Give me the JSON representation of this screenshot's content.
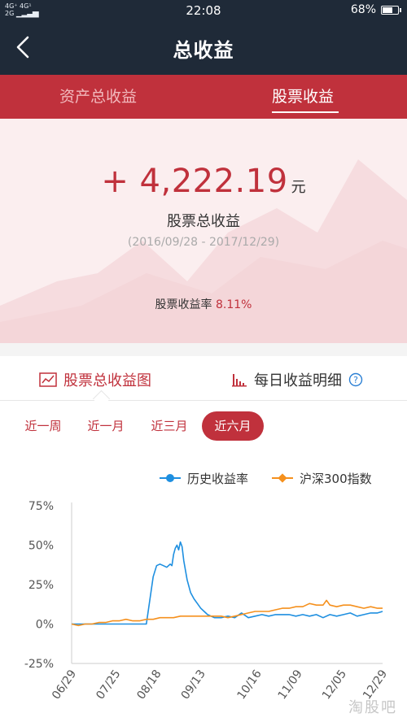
{
  "status_bar": {
    "network_top": "4G⁺ 4G¹",
    "network_bottom": "2G",
    "time": "22:08",
    "battery": "68%",
    "battery_level": 0.68
  },
  "header": {
    "title": "总收益"
  },
  "tabs": [
    {
      "label": "资产总收益",
      "active": false
    },
    {
      "label": "股票收益",
      "active": true
    }
  ],
  "summary": {
    "total_value": "+ 4,222.19",
    "unit": "元",
    "label": "股票总收益",
    "range": "(2016/09/28 - 2017/12/29)",
    "rate_label": "股票收益率",
    "rate_value": "8.11%"
  },
  "chart_tabs": {
    "left": {
      "label": "股票总收益图",
      "icon": "line-chart-icon"
    },
    "right": {
      "label": "每日收益明细",
      "icon": "bar-chart-icon",
      "help_icon": "question-icon"
    }
  },
  "periods": [
    {
      "label": "近一周",
      "active": false
    },
    {
      "label": "近一月",
      "active": false
    },
    {
      "label": "近三月",
      "active": false
    },
    {
      "label": "近六月",
      "active": true
    }
  ],
  "colors": {
    "accent": "#c0313c",
    "navy": "#1f2a38",
    "series_history": "#1e8fe0",
    "series_index": "#f5901d"
  },
  "watermark": "淘股吧",
  "chart_data": {
    "type": "line",
    "title": "",
    "xlabel": "",
    "ylabel": "",
    "ylim": [
      -25,
      75
    ],
    "yticks": [
      "75%",
      "50%",
      "25%",
      "0%",
      "-25%"
    ],
    "ytick_values": [
      75,
      50,
      25,
      0,
      -25
    ],
    "xticks": [
      "06/29",
      "07/25",
      "08/18",
      "09/13",
      "10/16",
      "11/09",
      "12/05",
      "12/29"
    ],
    "xtick_days": [
      0,
      26,
      50,
      76,
      109,
      133,
      159,
      183
    ],
    "series": [
      {
        "name": "历史收益率",
        "color": "#1e8fe0",
        "x": [
          0,
          3,
          6,
          10,
          15,
          20,
          25,
          30,
          35,
          40,
          44,
          46,
          48,
          50,
          52,
          54,
          56,
          58,
          59,
          60,
          61,
          62,
          63,
          64,
          65,
          66,
          68,
          70,
          72,
          74,
          76,
          78,
          80,
          84,
          88,
          92,
          96,
          100,
          104,
          108,
          112,
          116,
          120,
          124,
          128,
          132,
          136,
          140,
          144,
          148,
          152,
          156,
          160,
          164,
          168,
          172,
          176,
          180,
          183
        ],
        "y": [
          0,
          0,
          0,
          0,
          0,
          0,
          0,
          0,
          0,
          0,
          0,
          15,
          30,
          37,
          38,
          37,
          36,
          38,
          37,
          44,
          48,
          50,
          47,
          52,
          49,
          40,
          28,
          20,
          16,
          13,
          10,
          8,
          6,
          4,
          4,
          5,
          4,
          7,
          4,
          5,
          6,
          5,
          6,
          6,
          6,
          5,
          6,
          5,
          6,
          4,
          6,
          5,
          6,
          7,
          5,
          6,
          7,
          7,
          8
        ]
      },
      {
        "name": "沪深300指数",
        "color": "#f5901d",
        "x": [
          0,
          4,
          8,
          12,
          16,
          20,
          24,
          28,
          32,
          36,
          40,
          44,
          48,
          52,
          56,
          60,
          64,
          68,
          72,
          76,
          80,
          84,
          88,
          92,
          96,
          100,
          104,
          108,
          112,
          116,
          120,
          124,
          128,
          132,
          136,
          140,
          144,
          148,
          150,
          152,
          156,
          160,
          164,
          168,
          172,
          176,
          180,
          183
        ],
        "y": [
          0,
          -1,
          0,
          0,
          1,
          1,
          2,
          2,
          3,
          2,
          2,
          3,
          3,
          4,
          4,
          4,
          5,
          5,
          5,
          5,
          5,
          5,
          5,
          4,
          5,
          6,
          7,
          8,
          8,
          8,
          9,
          10,
          10,
          11,
          11,
          13,
          12,
          12,
          15,
          12,
          11,
          12,
          12,
          11,
          10,
          11,
          10,
          10
        ]
      }
    ],
    "legend_position": "top-right",
    "grid": false
  }
}
